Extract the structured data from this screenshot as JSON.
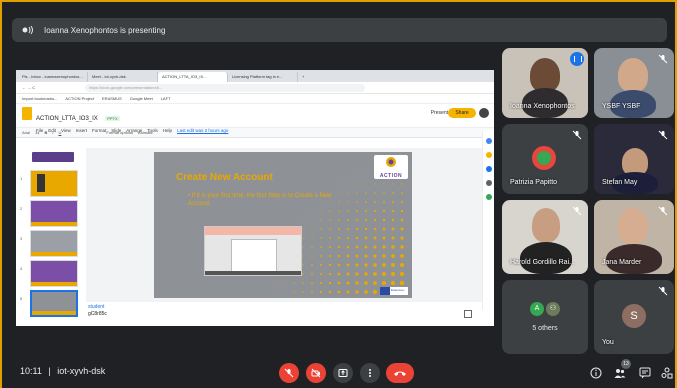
{
  "presenting_banner": "Ioanna Xenophontos is presenting",
  "shared_screen": {
    "browser_tabs": [
      "Pis - Inbox - ioannaxenophontos...",
      "Meet - iot-xyvh-dsk",
      "ACTION_LTTA_IO3_IX...",
      "Licensing Platform tag in e...",
      "+"
    ],
    "address": "https://docs.google.com/presentation/d/...",
    "bookmarks": [
      "Import bookmarks...",
      "ACTION Project",
      "ERASMUS",
      "Google Meet",
      "LAFT"
    ],
    "doc_title": "ACTION_LTTA_IO3_IX",
    "doc_badge": "PPTX",
    "menu": [
      "File",
      "Edit",
      "View",
      "Insert",
      "Format",
      "Slide",
      "Arrange",
      "Tools",
      "Help",
      "Last edit was 2 hours ago"
    ],
    "present_label": "Present",
    "share_label": "Share",
    "toolbar": [
      "Arial",
      "14",
      "B",
      "I",
      "U",
      "Format options",
      "Animate"
    ],
    "slide_numbers": [
      "1",
      "2",
      "3",
      "4",
      "5",
      "6"
    ],
    "slide": {
      "title": "Create New Account",
      "bullet": "If it is your first time, the first Step is to Create a New Account",
      "logo_text": "ACTION",
      "eu_text": "Erasmus+"
    },
    "notes_line1": "student",
    "notes_line2": "gC8r85c"
  },
  "participants": [
    {
      "name": "Ioanna Xenophontos",
      "state": "speaking"
    },
    {
      "name": "YSBF YSBF",
      "state": "muted"
    },
    {
      "name": "Patrizia Papitto",
      "state": "muted"
    },
    {
      "name": "Stefan May",
      "state": "muted"
    },
    {
      "name": "Harold Gordillo Rai...",
      "state": "muted"
    },
    {
      "name": "Jana Marder",
      "state": "muted"
    },
    {
      "name": "5 others",
      "avatars": [
        "A",
        "⚇"
      ]
    },
    {
      "name": "You",
      "avatar": "S",
      "state": "muted"
    }
  ],
  "bottom": {
    "time": "10:11",
    "separator": "|",
    "meeting_code": "iot-xyvh-dsk",
    "people_count": "13"
  },
  "colors": {
    "accent": "#e0a100",
    "red": "#ea4335",
    "tile_bg": "#3c4043",
    "page_bg": "#202124"
  }
}
